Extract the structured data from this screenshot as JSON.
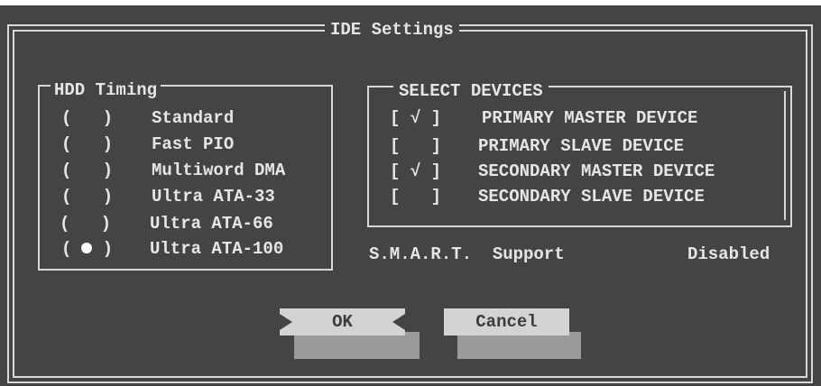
{
  "dialog": {
    "title": "IDE Settings"
  },
  "hdd_timing": {
    "title": "HDD Timing",
    "selected_index": 5,
    "options": [
      {
        "mark": "(   )",
        "label": "Standard"
      },
      {
        "mark": "(   )",
        "label": "Fast PIO"
      },
      {
        "mark": "(   )",
        "label": "Multiword DMA"
      },
      {
        "mark": "(   )",
        "label": "Ultra ATA-33"
      },
      {
        "mark": "(   )",
        "label": "Ultra ATA-66"
      },
      {
        "mark": "(   )",
        "label": "Ultra ATA-100"
      }
    ]
  },
  "devices": {
    "title": "SELECT DEVICES",
    "items": [
      {
        "mark": "[ √ ]",
        "label": "PRIMARY MASTER DEVICE",
        "checked": true
      },
      {
        "mark": "[   ]",
        "label": "PRIMARY SLAVE DEVICE",
        "checked": false
      },
      {
        "mark": "[ √ ]",
        "label": "SECONDARY MASTER DEVICE",
        "checked": true
      },
      {
        "mark": "[   ]",
        "label": "SECONDARY SLAVE DEVICE",
        "checked": false
      }
    ]
  },
  "smart": {
    "label": "S.M.A.R.T.  Support",
    "value": "Disabled"
  },
  "buttons": {
    "ok": "OK",
    "cancel": "Cancel"
  },
  "colors": {
    "background": "#444444",
    "text": "#e6e6e6",
    "button": "#d3d3d3",
    "button_shadow": "#9a9a9a"
  }
}
